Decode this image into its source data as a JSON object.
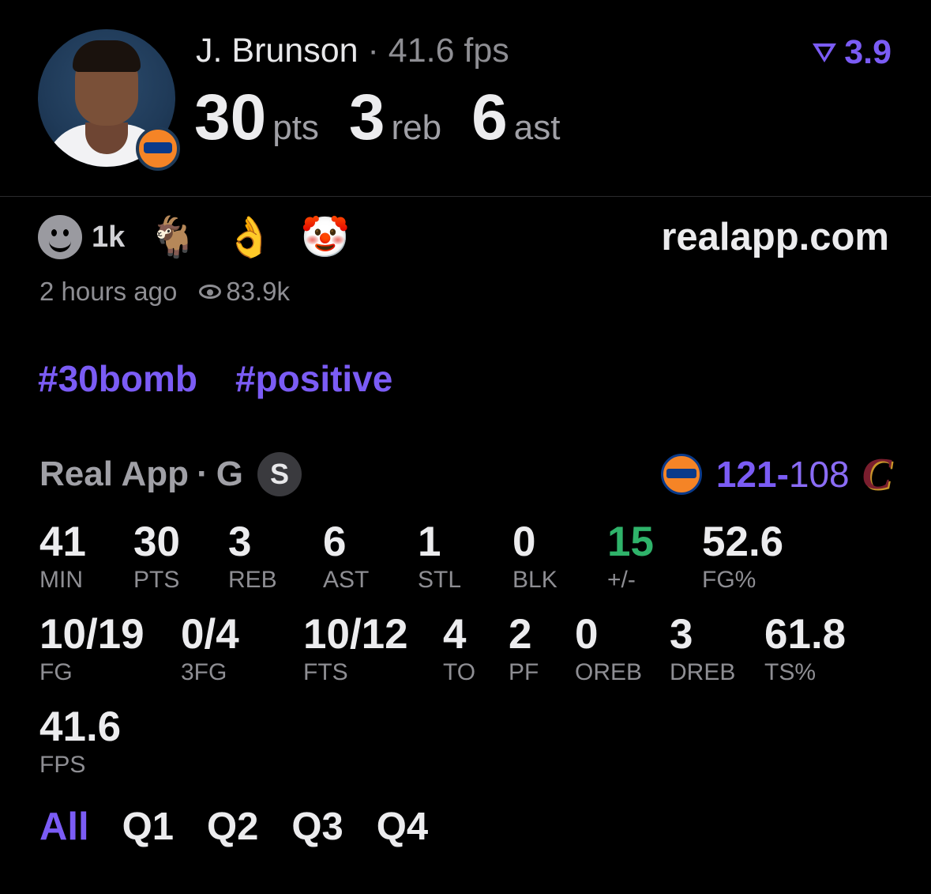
{
  "header": {
    "player_name": "J. Brunson",
    "separator": "·",
    "fps_text": "41.6 fps",
    "rating": "3.9",
    "stats": [
      {
        "value": "30",
        "unit": "pts"
      },
      {
        "value": "3",
        "unit": "reb"
      },
      {
        "value": "6",
        "unit": "ast"
      }
    ]
  },
  "reactions": {
    "count": "1k",
    "emojis": [
      "goat-emoji",
      "pinched-fingers-emoji",
      "clown-emoji"
    ]
  },
  "site": "realapp.com",
  "meta": {
    "time": "2 hours ago",
    "views": "83.9k"
  },
  "tags": [
    "#30bomb",
    "#positive"
  ],
  "game": {
    "source": "Real App",
    "position": "G",
    "badge": "S",
    "home_score": "121",
    "dash": "-",
    "away_score": "108",
    "away_logo_letter": "C"
  },
  "stats": {
    "row1": [
      {
        "value": "41",
        "label": "MIN"
      },
      {
        "value": "30",
        "label": "PTS"
      },
      {
        "value": "3",
        "label": "REB"
      },
      {
        "value": "6",
        "label": "AST"
      },
      {
        "value": "1",
        "label": "STL"
      },
      {
        "value": "0",
        "label": "BLK"
      },
      {
        "value": "15",
        "label": "+/-"
      },
      {
        "value": "52.6",
        "label": "FG%"
      }
    ],
    "row2": [
      {
        "value": "10/19",
        "label": "FG"
      },
      {
        "value": "0/4",
        "label": "3FG"
      },
      {
        "value": "10/12",
        "label": "FTS"
      },
      {
        "value": "4",
        "label": "TO"
      },
      {
        "value": "2",
        "label": "PF"
      },
      {
        "value": "0",
        "label": "OREB"
      },
      {
        "value": "3",
        "label": "DREB"
      },
      {
        "value": "61.8",
        "label": "TS%"
      }
    ],
    "row3": [
      {
        "value": "41.6",
        "label": "FPS"
      }
    ]
  },
  "quarters": [
    "All",
    "Q1",
    "Q2",
    "Q3",
    "Q4"
  ],
  "colors": {
    "accent": "#7b5cf5",
    "positive": "#2fb36a",
    "muted": "#8e8e93"
  }
}
